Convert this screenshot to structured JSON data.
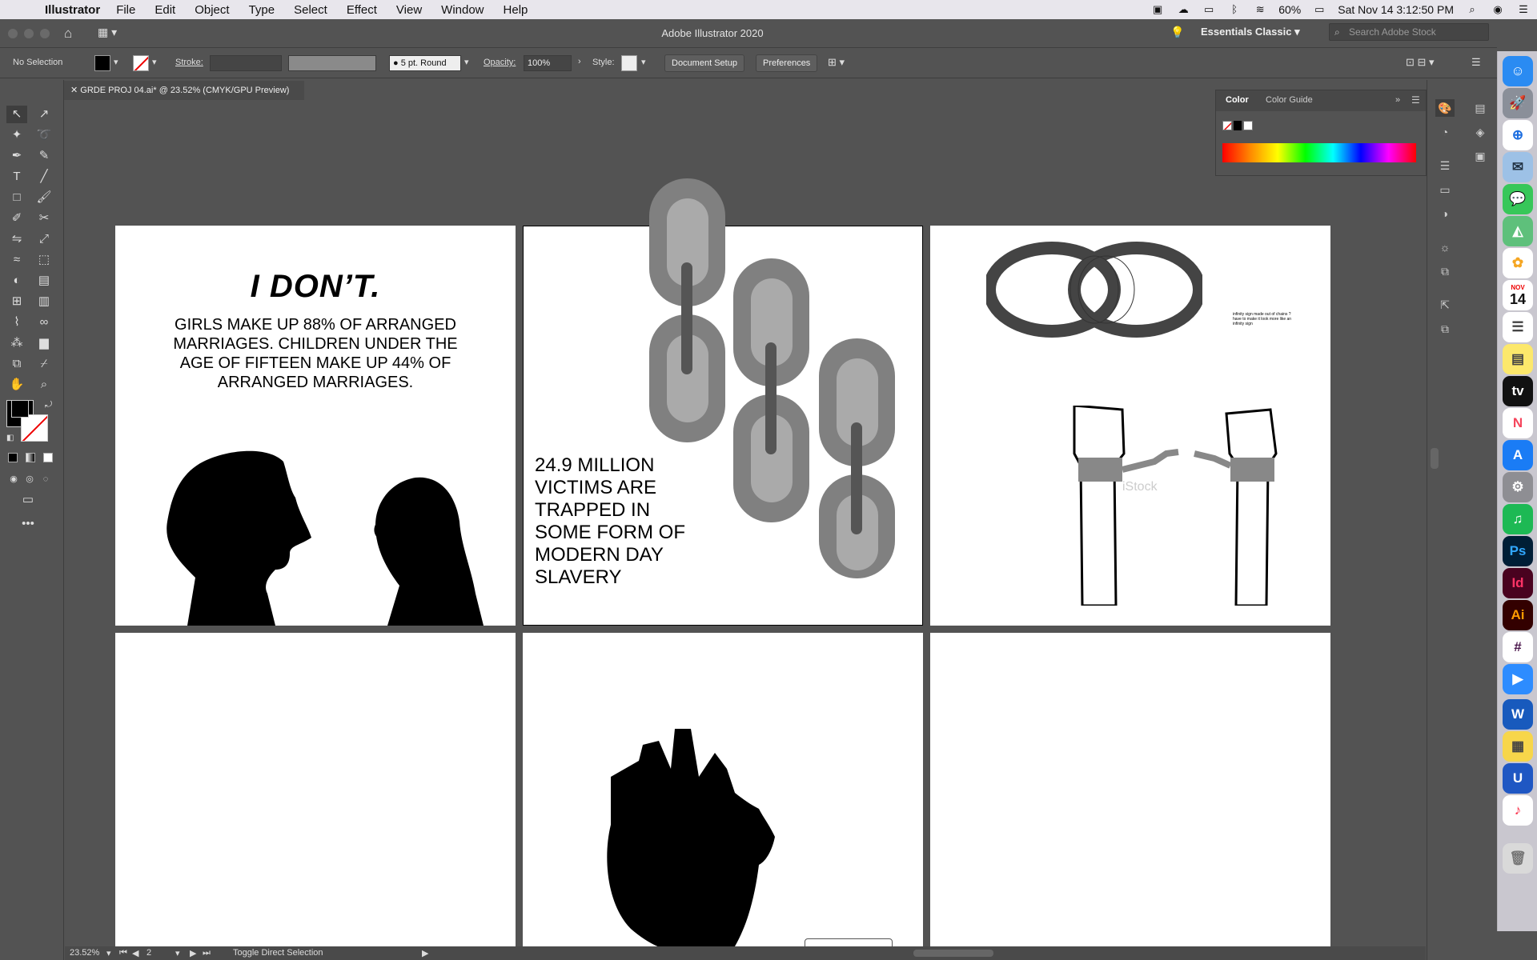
{
  "menubar": {
    "app_name": "Illustrator",
    "items": [
      "File",
      "Edit",
      "Object",
      "Type",
      "Select",
      "Effect",
      "View",
      "Window",
      "Help"
    ],
    "battery": "60%",
    "clock": "Sat Nov 14  3:12:50 PM"
  },
  "appbar": {
    "title": "Adobe Illustrator 2020",
    "workspace": "Essentials Classic",
    "search_placeholder": "Search Adobe Stock"
  },
  "controlbar": {
    "selection": "No Selection",
    "stroke_label": "Stroke:",
    "brush": "5 pt. Round",
    "opacity_label": "Opacity:",
    "opacity_value": "100%",
    "style_label": "Style:",
    "doc_setup": "Document Setup",
    "preferences": "Preferences"
  },
  "doc_tab": {
    "label": "GRDE PROJ 04.ai* @ 23.52% (CMYK/GPU Preview)"
  },
  "color_panel": {
    "tabs": [
      "Color",
      "Color Guide"
    ]
  },
  "artboards": {
    "ab1_title": "I DON’T.",
    "ab1_body": "GIRLS MAKE UP 88% OF ARRANGED MARRIAGES. CHILDREN UNDER THE AGE OF FIFTEEN MAKE UP 44% OF ARRANGED MARRIAGES.",
    "ab2_body": "24.9 MILLION VICTIMS ARE TRAPPED IN SOME FORM OF MODERN DAY SLAVERY",
    "ab3_note": "infinity sign made out of chains ? have to make it look more like an infinity sign",
    "ab3_watermark": "iStock"
  },
  "dock": {
    "calendar_month": "NOV",
    "calendar_day": "14",
    "apps": [
      {
        "name": "ps-app",
        "label": "Ps",
        "color": "#001e36",
        "fg": "#31a8ff"
      },
      {
        "name": "id-app",
        "label": "Id",
        "color": "#49021f",
        "fg": "#ff3366"
      },
      {
        "name": "ai-app",
        "label": "Ai",
        "color": "#330000",
        "fg": "#ff9a00"
      }
    ]
  },
  "statusbar": {
    "zoom": "23.52%",
    "page": "2",
    "hint": "Toggle Direct Selection"
  }
}
